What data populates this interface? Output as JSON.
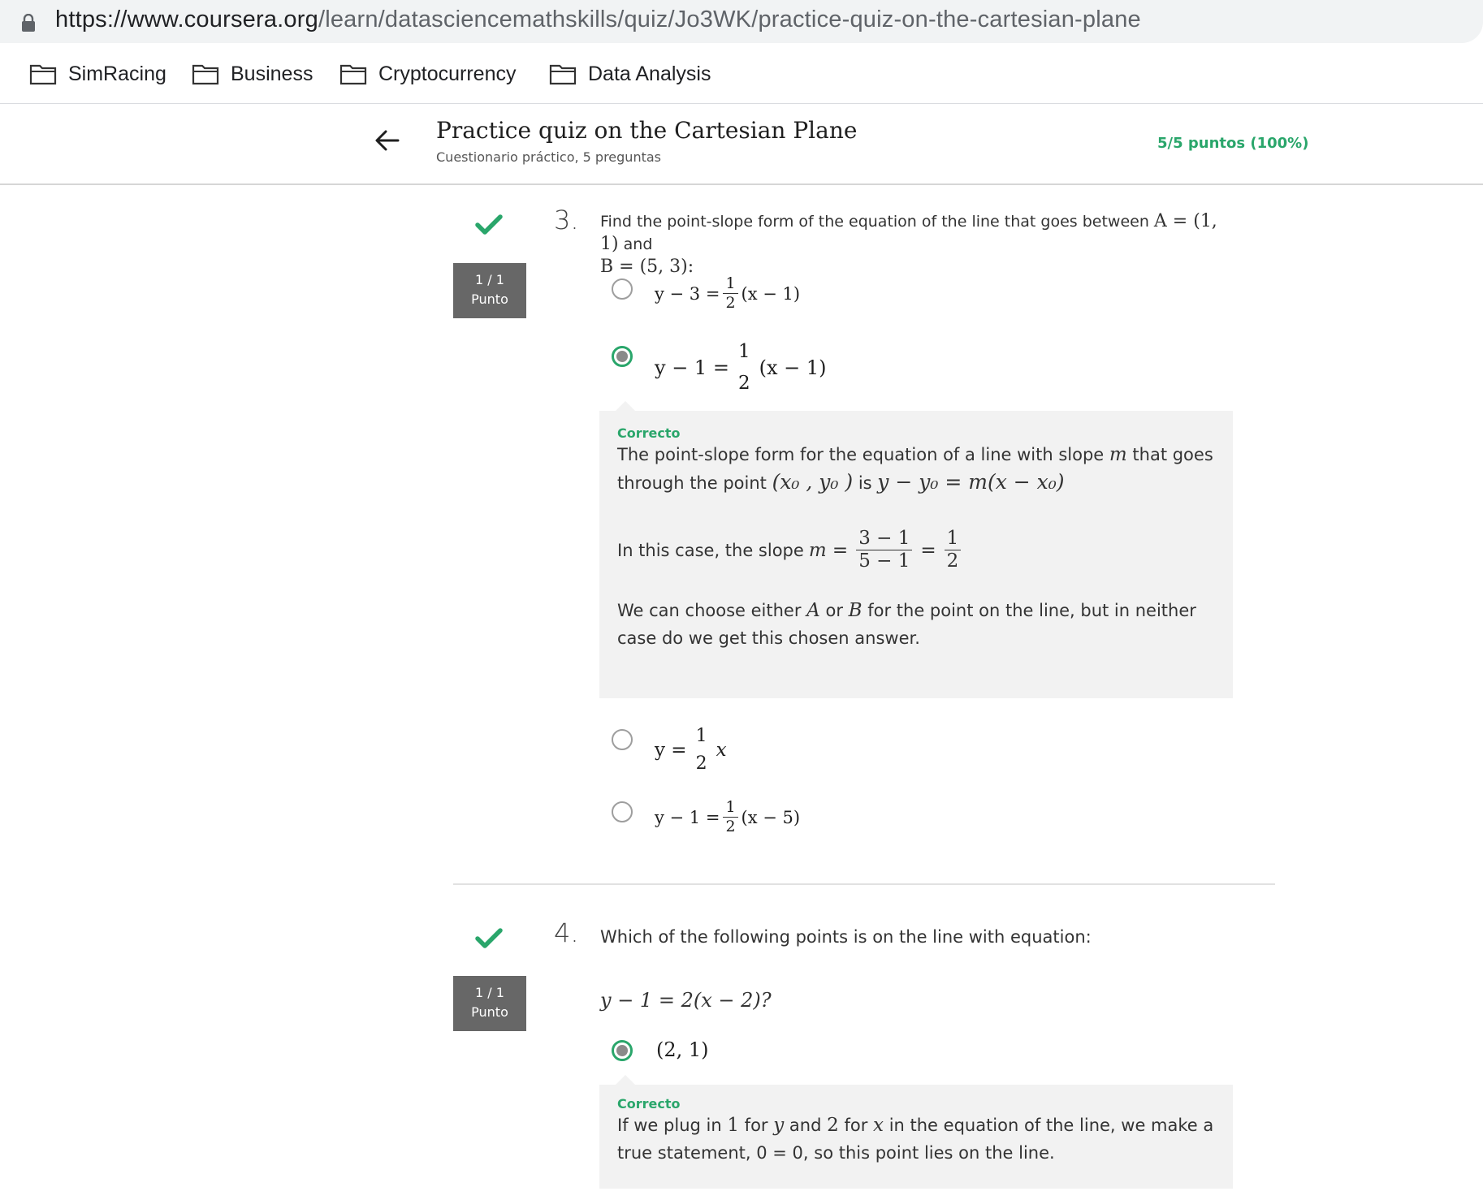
{
  "browser": {
    "url_host": "https://www.coursera.org",
    "url_path": "/learn/datasciencemathskills/quiz/Jo3WK/practice-quiz-on-the-cartesian-plane",
    "bookmarks": [
      {
        "label": "SimRacing"
      },
      {
        "label": "Business"
      },
      {
        "label": "Cryptocurrency"
      },
      {
        "label": "Data Analysis"
      }
    ]
  },
  "quiz": {
    "title": "Practice quiz on the Cartesian Plane",
    "subtitle": "Cuestionario práctico, 5 preguntas",
    "score": "5/5 puntos (100%)"
  },
  "questions": [
    {
      "number": "3.",
      "points": "1 / 1",
      "points_label": "Punto",
      "prompt_pre": "Find the point-slope form of the equation of the line that goes between",
      "prompt_a": "A = (1, 1)",
      "prompt_and": "and",
      "prompt_b": "B = (5, 3):",
      "options": [
        {
          "lhs": "y − 3 =",
          "num": "1",
          "den": "2",
          "rhs": "(x − 1)",
          "selected": false
        },
        {
          "lhs": "y − 1 =",
          "num": "1",
          "den": "2",
          "rhs": "(x − 1)",
          "selected": true
        },
        {
          "lhs": "y =",
          "num": "1",
          "den": "2",
          "rhs": "x",
          "selected": false
        },
        {
          "lhs": "y − 1 =",
          "num": "1",
          "den": "2",
          "rhs": "(x − 5)",
          "selected": false
        }
      ],
      "feedback": {
        "label": "Correcto",
        "p1_pre": "The point-slope form for the equation of a line with slope",
        "p1_m": "m",
        "p1_mid": "that goes through the point",
        "p1_point": "(x₀ , y₀ )",
        "p1_is": "is",
        "p1_eq": "y − y₀ = m(x − x₀)",
        "p2_pre": "In this case, the slope",
        "p2_m": "m =",
        "p2_num1": "3 − 1",
        "p2_den1": "5 − 1",
        "p2_eq": "=",
        "p2_num2": "1",
        "p2_den2": "2",
        "p3_pre": "We can choose either",
        "p3_a": "A",
        "p3_or": "or",
        "p3_b": "B",
        "p3_post": "for the point on the line, but in neither case do we get this chosen answer."
      }
    },
    {
      "number": "4.",
      "points": "1 / 1",
      "points_label": "Punto",
      "prompt": "Which of the following points is on the line with equation:",
      "equation": "y − 1 = 2(x − 2)?",
      "options": [
        {
          "label": "(2, 1)",
          "selected": true
        }
      ],
      "feedback": {
        "label": "Correcto",
        "pre": "If we plug in",
        "v1": "1",
        "for1": "for",
        "y": "y",
        "and": "and",
        "v2": "2",
        "for2": "for",
        "x": "x",
        "post": "in the equation of the line, we make a true statement, 0 = 0, so this point lies on the line."
      }
    }
  ],
  "colors": {
    "accent_green": "#2aa66b",
    "badge_gray": "#676767",
    "feedback_bg": "#f2f2f2"
  }
}
